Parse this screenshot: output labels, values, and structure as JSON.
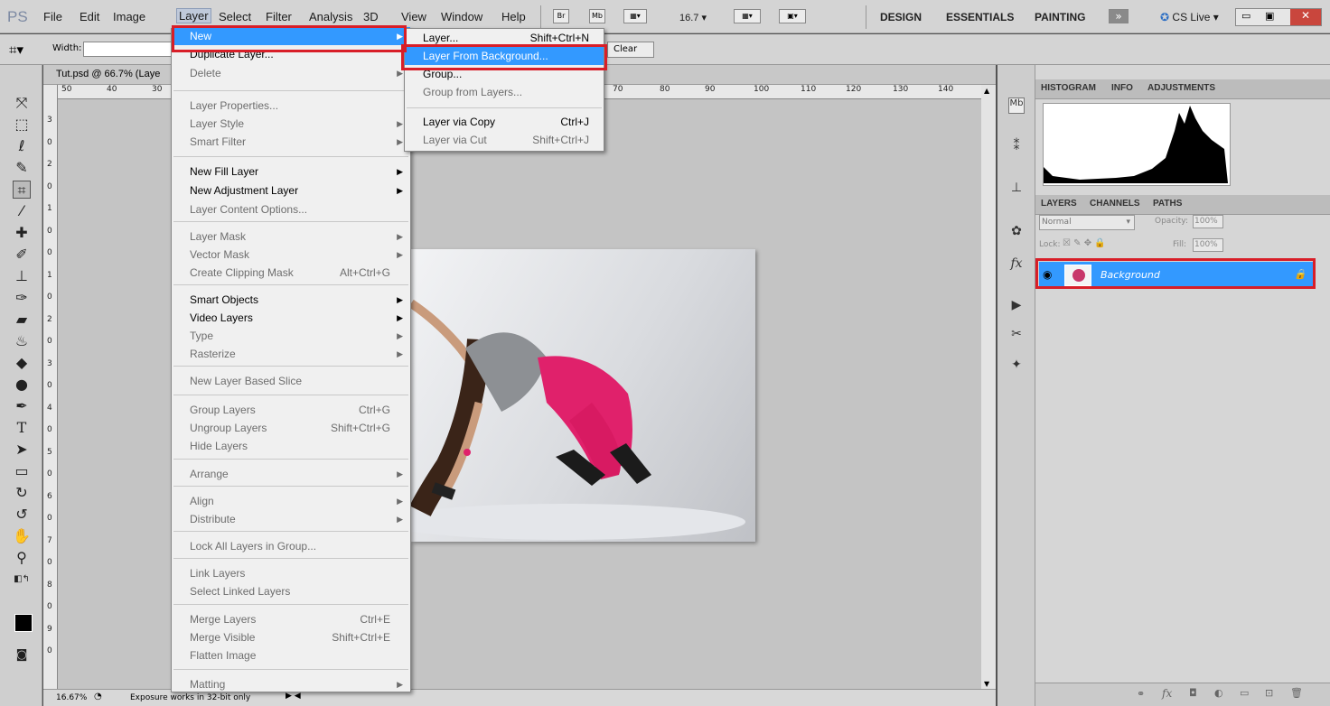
{
  "app": {
    "logo": "PS"
  },
  "menubar": {
    "items": [
      "File",
      "Edit",
      "Image",
      "Layer",
      "Select",
      "Filter",
      "Analysis",
      "3D",
      "View",
      "Window",
      "Help"
    ],
    "icons": {
      "bridge": "Br",
      "minibridge": "Mb"
    },
    "zoom": "16.7",
    "workspaces": [
      "DESIGN",
      "ESSENTIALS",
      "PAINTING"
    ],
    "more": "»",
    "cslive": "CS Live"
  },
  "options": {
    "width_label": "Width:",
    "clear_label": "Clear"
  },
  "document": {
    "tab_title": "Tut.psd @ 66.7% (Laye",
    "ruler_h": [
      "50",
      "40",
      "30",
      "70",
      "80",
      "90",
      "100",
      "110",
      "120",
      "130",
      "140"
    ],
    "ruler_v": [
      "3",
      "0",
      "2",
      "0",
      "1",
      "0",
      "0",
      "1",
      "0",
      "2",
      "0",
      "3",
      "0",
      "4",
      "0",
      "5",
      "0",
      "6",
      "0",
      "7",
      "0",
      "8",
      "0",
      "9",
      "0"
    ]
  },
  "status": {
    "zoom": "16.67%",
    "message": "Exposure works in 32-bit only"
  },
  "layer_menu": {
    "items": [
      {
        "label": "New",
        "shortcut": "",
        "arrow": true,
        "state": "highlight"
      },
      {
        "label": "Duplicate Layer...",
        "shortcut": "",
        "arrow": false,
        "state": "enabled"
      },
      {
        "label": "Delete",
        "shortcut": "",
        "arrow": true,
        "state": "disabled"
      },
      {
        "label": "Layer Properties...",
        "shortcut": "",
        "arrow": false,
        "state": "disabled",
        "sep": true
      },
      {
        "label": "Layer Style",
        "shortcut": "",
        "arrow": true,
        "state": "disabled"
      },
      {
        "label": "Smart Filter",
        "shortcut": "",
        "arrow": true,
        "state": "disabled"
      },
      {
        "label": "New Fill Layer",
        "shortcut": "",
        "arrow": true,
        "state": "enabled",
        "sep": true
      },
      {
        "label": "New Adjustment Layer",
        "shortcut": "",
        "arrow": true,
        "state": "enabled"
      },
      {
        "label": "Layer Content Options...",
        "shortcut": "",
        "arrow": false,
        "state": "disabled"
      },
      {
        "label": "Layer Mask",
        "shortcut": "",
        "arrow": true,
        "state": "disabled",
        "sep": true
      },
      {
        "label": "Vector Mask",
        "shortcut": "",
        "arrow": true,
        "state": "disabled"
      },
      {
        "label": "Create Clipping Mask",
        "shortcut": "Alt+Ctrl+G",
        "arrow": false,
        "state": "disabled"
      },
      {
        "label": "Smart Objects",
        "shortcut": "",
        "arrow": true,
        "state": "enabled",
        "sep": true
      },
      {
        "label": "Video Layers",
        "shortcut": "",
        "arrow": true,
        "state": "enabled"
      },
      {
        "label": "Type",
        "shortcut": "",
        "arrow": true,
        "state": "disabled"
      },
      {
        "label": "Rasterize",
        "shortcut": "",
        "arrow": true,
        "state": "disabled"
      },
      {
        "label": "New Layer Based Slice",
        "shortcut": "",
        "arrow": false,
        "state": "disabled",
        "sep": true
      },
      {
        "label": "Group Layers",
        "shortcut": "Ctrl+G",
        "arrow": false,
        "state": "disabled",
        "sep": true
      },
      {
        "label": "Ungroup Layers",
        "shortcut": "Shift+Ctrl+G",
        "arrow": false,
        "state": "disabled"
      },
      {
        "label": "Hide Layers",
        "shortcut": "",
        "arrow": false,
        "state": "disabled"
      },
      {
        "label": "Arrange",
        "shortcut": "",
        "arrow": true,
        "state": "disabled",
        "sep": true
      },
      {
        "label": "Align",
        "shortcut": "",
        "arrow": true,
        "state": "disabled",
        "sep": true
      },
      {
        "label": "Distribute",
        "shortcut": "",
        "arrow": true,
        "state": "disabled"
      },
      {
        "label": "Lock All Layers in Group...",
        "shortcut": "",
        "arrow": false,
        "state": "disabled",
        "sep": true
      },
      {
        "label": "Link Layers",
        "shortcut": "",
        "arrow": false,
        "state": "disabled",
        "sep": true
      },
      {
        "label": "Select Linked Layers",
        "shortcut": "",
        "arrow": false,
        "state": "disabled"
      },
      {
        "label": "Merge Layers",
        "shortcut": "Ctrl+E",
        "arrow": false,
        "state": "disabled",
        "sep": true
      },
      {
        "label": "Merge Visible",
        "shortcut": "Shift+Ctrl+E",
        "arrow": false,
        "state": "disabled"
      },
      {
        "label": "Flatten Image",
        "shortcut": "",
        "arrow": false,
        "state": "disabled"
      },
      {
        "label": "Matting",
        "shortcut": "",
        "arrow": true,
        "state": "disabled",
        "sep": true
      }
    ]
  },
  "new_submenu": {
    "items": [
      {
        "label": "Layer...",
        "shortcut": "Shift+Ctrl+N",
        "state": "enabled"
      },
      {
        "label": "Layer From Background...",
        "shortcut": "",
        "state": "highlight"
      },
      {
        "label": "Group...",
        "shortcut": "",
        "state": "enabled"
      },
      {
        "label": "Group from Layers...",
        "shortcut": "",
        "state": "disabled"
      },
      {
        "label": "Layer via Copy",
        "shortcut": "Ctrl+J",
        "state": "enabled",
        "sep": true
      },
      {
        "label": "Layer via Cut",
        "shortcut": "Shift+Ctrl+J",
        "state": "disabled"
      }
    ]
  },
  "panels": {
    "top_tabs": [
      "HISTOGRAM",
      "INFO",
      "ADJUSTMENTS"
    ],
    "layer_tabs": [
      "LAYERS",
      "CHANNELS",
      "PATHS"
    ],
    "blend_mode": "Normal",
    "opacity_label": "Opacity:",
    "opacity_value": "100%",
    "lock_label": "Lock:",
    "fill_label": "Fill:",
    "fill_value": "100%",
    "layer_name": "Background"
  },
  "colors": {
    "highlight": "#3399ff",
    "redbox": "#d81e28"
  }
}
